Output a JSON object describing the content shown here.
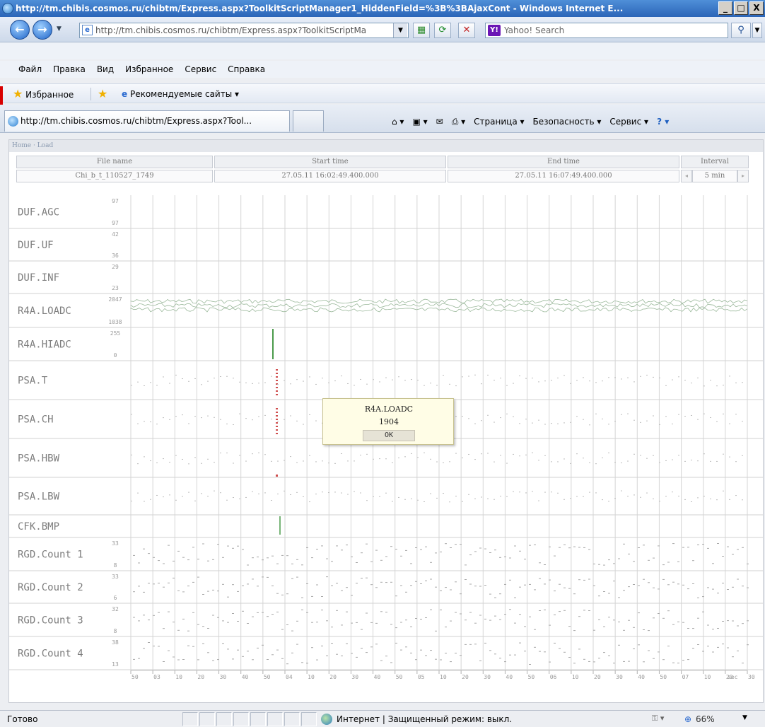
{
  "window": {
    "title": "http://tm.chibis.cosmos.ru/chibtm/Express.aspx?ToolkitScriptManager1_HiddenField=%3B%3BAjaxCont - Windows Internet E...",
    "controls": [
      "_",
      "□",
      "X"
    ]
  },
  "addressbar": {
    "url": "http://tm.chibis.cosmos.ru/chibtm/Express.aspx?ToolkitScriptMa",
    "search_placeholder": "Yahoo! Search"
  },
  "menu": [
    "Файл",
    "Правка",
    "Вид",
    "Избранное",
    "Сервис",
    "Справка"
  ],
  "favorites": {
    "favorites_label": "Избранное",
    "recommended_label": "Рекомендуемые сайты ▾"
  },
  "tab": {
    "title": "http://tm.chibis.cosmos.ru/chibtm/Express.aspx?Tool..."
  },
  "commandbar": {
    "page": "Страница",
    "safety": "Безопасность",
    "service": "Сервис"
  },
  "page": {
    "breadcrumb": "Home · Load",
    "headers": {
      "file_name": "File name",
      "start_time": "Start time",
      "end_time": "End time",
      "interval": "Interval"
    },
    "values": {
      "file_name": "Chi_b_t_110527_1749",
      "start_time": "27.05.11 16:02:49.400.000",
      "end_time": "27.05.11 16:07:49.400.000",
      "interval": "5 min"
    }
  },
  "chart_data": {
    "type": "line",
    "signals": [
      {
        "name": "DUF.AGC",
        "max": "97",
        "min": "97"
      },
      {
        "name": "DUF.UF",
        "max": "42",
        "min": "36"
      },
      {
        "name": "DUF.INF",
        "max": "29",
        "min": "23"
      },
      {
        "name": "R4A.LOADC",
        "max": "2047",
        "min": "1038"
      },
      {
        "name": "R4A.HIADC",
        "max": "255",
        "min": "0"
      },
      {
        "name": "PSA.T",
        "max": "",
        "min": ""
      },
      {
        "name": "PSA.CH",
        "max": "",
        "min": ""
      },
      {
        "name": "PSA.HBW",
        "max": "",
        "min": ""
      },
      {
        "name": "PSA.LBW",
        "max": "",
        "min": ""
      },
      {
        "name": "CFK.BMP",
        "max": "",
        "min": ""
      },
      {
        "name": "RGD.Count 1",
        "max": "33",
        "min": "8"
      },
      {
        "name": "RGD.Count 2",
        "max": "33",
        "min": "6"
      },
      {
        "name": "RGD.Count 3",
        "max": "32",
        "min": "8"
      },
      {
        "name": "RGD.Count 4",
        "max": "38",
        "min": "13"
      }
    ],
    "x_ticks": [
      "50",
      "03",
      "10",
      "20",
      "30",
      "40",
      "50",
      "04",
      "10",
      "20",
      "30",
      "40",
      "50",
      "05",
      "10",
      "20",
      "30",
      "40",
      "50",
      "06",
      "10",
      "20",
      "30",
      "40",
      "50",
      "07",
      "10",
      "20",
      "30"
    ],
    "x_unit": "sec"
  },
  "dialog": {
    "title": "R4A.LOADC",
    "value": "1904",
    "ok": "OK"
  },
  "statusbar": {
    "status": "Готово",
    "zone": "Интернет | Защищенный режим: выкл.",
    "zoom": "66%"
  }
}
